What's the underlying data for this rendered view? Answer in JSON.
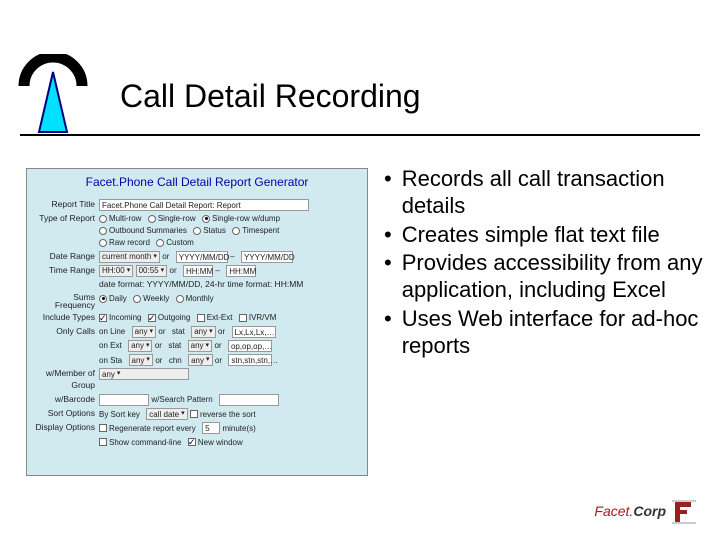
{
  "title": "Call Detail Recording",
  "form": {
    "title": "Facet.Phone Call Detail Report Generator",
    "rows": {
      "report_title": {
        "label": "Report Title",
        "value": "Facet.Phone Call Detail Report: Report"
      },
      "type_of_report": {
        "label": "Type of Report",
        "options": [
          "Multi-row",
          "Single-row",
          "Single-row w/dump",
          "Outbound Summaries",
          "Status",
          "Timespent",
          "Raw record",
          "Custom"
        ],
        "selected": 2
      },
      "date_range": {
        "label": "Date Range",
        "select": "current month",
        "or": "or",
        "from": "YYYY/MM/DD",
        "dash": "–",
        "to": "YYYY/MM/DD"
      },
      "time_range": {
        "label": "Time Range",
        "from_h": "HH:00",
        "from_m": "00:55",
        "or": "or",
        "mid_h": "HH:MM",
        "dash": "–",
        "to_h": "HH:MM"
      },
      "date_format_note": "date format: YYYY/MM/DD, 24-hr time format: HH:MM",
      "sums_frequency": {
        "label": "Sums Frequency",
        "options": [
          "Daily",
          "Weekly",
          "Monthly"
        ],
        "selected": 0
      },
      "include_types": {
        "label": "Include Types",
        "options": [
          {
            "label": "Incoming",
            "checked": true
          },
          {
            "label": "Outgoing",
            "checked": true
          },
          {
            "label": "Ext-Ext",
            "checked": false
          },
          {
            "label": "IVR/VM",
            "checked": false
          }
        ]
      },
      "only_calls": {
        "label": "Only Calls",
        "line1": {
          "on_l": "on Line",
          "sel": "any",
          "or": "or",
          "stat": "stat",
          "sel2": "any",
          "or2": "or",
          "val": "Lx,Lx,Lx,…"
        },
        "line2": {
          "on_e": "on Ext",
          "sel": "any",
          "or": "or",
          "stat": "stat",
          "sel2": "any",
          "or2": "or",
          "val": "op,op,op,…"
        },
        "line3": {
          "on_s": "on Sta",
          "sel": "any",
          "or": "or",
          "chn": "chn",
          "sel2": "any",
          "or2": "or",
          "val": "stn,stn,stn,…"
        }
      },
      "member_group": {
        "label": "w/Member of Group",
        "value": "any"
      },
      "barcode": {
        "label": "w/Barcode",
        "value": "",
        "search_label": "w/Search Pattern",
        "search_value": ""
      },
      "sort_options": {
        "label": "Sort Options",
        "by": "By Sort key",
        "key": "call date",
        "reverse_label": "reverse the sort",
        "reverse": false
      },
      "display_options": {
        "label": "Display Options",
        "regen_label": "Regenerate report every",
        "regen_value": "5",
        "minutes": "minute(s)"
      },
      "bottom": {
        "show_cmd_label": "Show command-line",
        "show_cmd": false,
        "new_window_label": "New window",
        "new_window": true
      }
    }
  },
  "bullets": [
    "Records all call transaction details",
    "Creates simple flat text file",
    "Provides accessibility from any application, including Excel",
    "Uses Web interface for ad-hoc reports"
  ],
  "footer": {
    "facet": "Facet.",
    "corp": "Corp"
  }
}
